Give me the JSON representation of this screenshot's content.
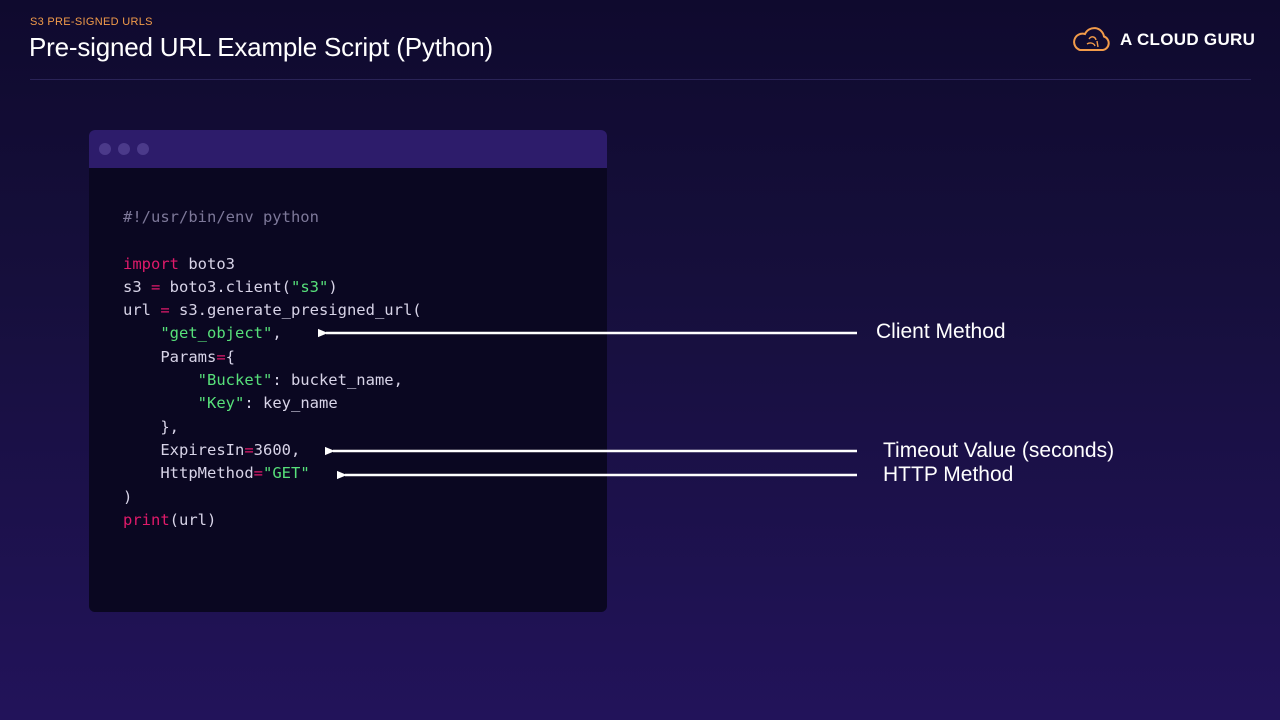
{
  "header": {
    "eyebrow": "S3 PRE-SIGNED URLS",
    "title": "Pre-signed URL Example Script (Python)",
    "brand": "A CLOUD GURU",
    "brand_icon": "cloud-logo-icon",
    "accent_color": "#f29b4a"
  },
  "code_window": {
    "lines": [
      [
        {
          "t": "#!/usr/bin/env python",
          "c": "comment"
        }
      ],
      [],
      [
        {
          "t": "import",
          "c": "kw"
        },
        {
          "t": " boto3",
          "c": ""
        }
      ],
      [
        {
          "t": "s3 ",
          "c": ""
        },
        {
          "t": "=",
          "c": "op"
        },
        {
          "t": " boto3.client(",
          "c": ""
        },
        {
          "t": "\"s3\"",
          "c": "str"
        },
        {
          "t": ")",
          "c": ""
        }
      ],
      [
        {
          "t": "url ",
          "c": ""
        },
        {
          "t": "=",
          "c": "op"
        },
        {
          "t": " s3.generate_presigned_url(",
          "c": ""
        }
      ],
      [
        {
          "t": "    ",
          "c": ""
        },
        {
          "t": "\"get_object\"",
          "c": "str"
        },
        {
          "t": ",",
          "c": ""
        }
      ],
      [
        {
          "t": "    Params",
          "c": ""
        },
        {
          "t": "=",
          "c": "op"
        },
        {
          "t": "{",
          "c": ""
        }
      ],
      [
        {
          "t": "        ",
          "c": ""
        },
        {
          "t": "\"Bucket\"",
          "c": "str"
        },
        {
          "t": ": bucket_name,",
          "c": ""
        }
      ],
      [
        {
          "t": "        ",
          "c": ""
        },
        {
          "t": "\"Key\"",
          "c": "str"
        },
        {
          "t": ": key_name",
          "c": ""
        }
      ],
      [
        {
          "t": "    },",
          "c": ""
        }
      ],
      [
        {
          "t": "    ExpiresIn",
          "c": ""
        },
        {
          "t": "=",
          "c": "op"
        },
        {
          "t": "3600,",
          "c": ""
        }
      ],
      [
        {
          "t": "    HttpMethod",
          "c": ""
        },
        {
          "t": "=",
          "c": "op"
        },
        {
          "t": "\"GET\"",
          "c": "str"
        }
      ],
      [
        {
          "t": ")",
          "c": ""
        }
      ],
      [
        {
          "t": "print",
          "c": "kw"
        },
        {
          "t": "(url)",
          "c": ""
        }
      ]
    ]
  },
  "annotations": {
    "client_method": "Client Method",
    "timeout_value": "Timeout Value (seconds)",
    "http_method": "HTTP Method"
  }
}
